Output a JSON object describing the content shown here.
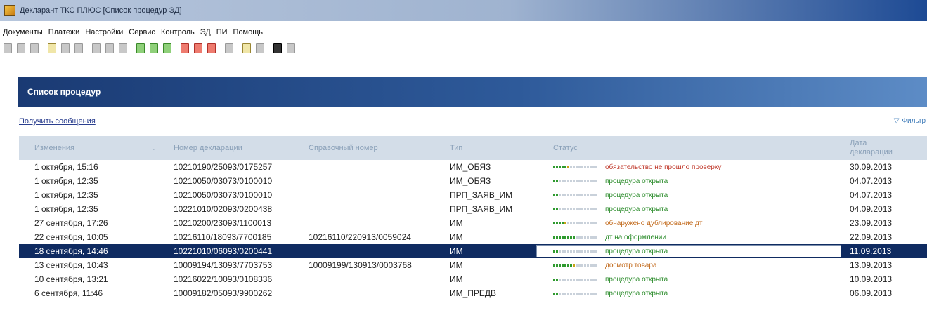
{
  "window": {
    "title": "Декларант ТКС ПЛЮС [Список процедур ЭД]"
  },
  "menu": [
    "Документы",
    "Платежи",
    "Настройки",
    "Сервис",
    "Контроль",
    "ЭД",
    "ПИ",
    "Помощь"
  ],
  "toolbar": {
    "icons": [
      {
        "name": "print-icon",
        "style": "gray"
      },
      {
        "name": "save-icon",
        "style": "gray"
      },
      {
        "name": "preview-icon",
        "style": "gray"
      },
      {
        "name": "sep"
      },
      {
        "name": "document-icon",
        "style": "doc"
      },
      {
        "name": "send-icon",
        "style": "gray"
      },
      {
        "name": "binoculars-icon",
        "style": "gray"
      },
      {
        "name": "sep"
      },
      {
        "name": "doc-new-icon",
        "style": "gray"
      },
      {
        "name": "doc-copy-icon",
        "style": "gray"
      },
      {
        "name": "doc-stack-icon",
        "style": "gray"
      },
      {
        "name": "sep"
      },
      {
        "name": "green-doc-icon",
        "style": "green"
      },
      {
        "name": "green-doc2-icon",
        "style": "green"
      },
      {
        "name": "green-stack-icon",
        "style": "green"
      },
      {
        "name": "sep"
      },
      {
        "name": "red-doc-icon",
        "style": "red"
      },
      {
        "name": "red-doc2-icon",
        "style": "red"
      },
      {
        "name": "red-stack-icon",
        "style": "red"
      },
      {
        "name": "sep"
      },
      {
        "name": "copy-icon",
        "style": "gray"
      },
      {
        "name": "sep"
      },
      {
        "name": "coin-icon",
        "style": "doc"
      },
      {
        "name": "book-icon",
        "style": "gray"
      },
      {
        "name": "sep"
      },
      {
        "name": "settings-icon",
        "style": "dark"
      },
      {
        "name": "list-icon",
        "style": "gray"
      }
    ]
  },
  "panel": {
    "title": "Список процедур",
    "get_messages": "Получить сообщения",
    "filter": "Фильтр"
  },
  "table": {
    "columns": {
      "changed": "Изменения",
      "decl": "Номер декларации",
      "ref": "Справочный номер",
      "type": "Тип",
      "status": "Статус",
      "date": "Дата декларации"
    },
    "rows": [
      {
        "changed": "1 октября, 15:16",
        "decl": "10210190/25093/0175257",
        "ref": "",
        "type": "ИМ_ОБЯЗ",
        "progress": 0.4,
        "status_color": "red",
        "status": "обязательство не прошло проверку",
        "date": "30.09.2013"
      },
      {
        "changed": "1 октября, 12:35",
        "decl": "10210050/03073/0100010",
        "ref": "",
        "type": "ИМ_ОБЯЗ",
        "progress": 0.1,
        "status_color": "green",
        "status": "процедура открыта",
        "date": "04.07.2013"
      },
      {
        "changed": "1 октября, 12:35",
        "decl": "10210050/03073/0100010",
        "ref": "",
        "type": "ПРП_ЗАЯВ_ИМ",
        "progress": 0.1,
        "status_color": "green",
        "status": "процедура открыта",
        "date": "04.07.2013"
      },
      {
        "changed": "1 октября, 12:35",
        "decl": "10221010/02093/0200438",
        "ref": "",
        "type": "ПРП_ЗАЯВ_ИМ",
        "progress": 0.1,
        "status_color": "green",
        "status": "процедура открыта",
        "date": "04.09.2013"
      },
      {
        "changed": "27 сентября, 17:26",
        "decl": "10210200/23093/1100013",
        "ref": "",
        "type": "ИМ",
        "progress": 0.3,
        "status_color": "orange",
        "status": "обнаружено дублирование дт",
        "date": "23.09.2013"
      },
      {
        "changed": "22 сентября, 10:05",
        "decl": "10216110/18093/7700185",
        "ref": "10216110/220913/0059024",
        "type": "ИМ",
        "progress": 0.5,
        "status_color": "green",
        "status": "дт на оформлении",
        "date": "22.09.2013"
      },
      {
        "changed": "18 сентября, 14:46",
        "decl": "10221010/06093/0200441",
        "ref": "",
        "type": "ИМ",
        "progress": 0.1,
        "status_color": "green",
        "status": "процедура открыта",
        "date": "11.09.2013",
        "selected": true
      },
      {
        "changed": "13 сентября, 10:43",
        "decl": "10009194/13093/7703753",
        "ref": "10009199/130913/0003768",
        "type": "ИМ",
        "progress": 0.5,
        "status_color": "orange",
        "status": "досмотр товара",
        "date": "13.09.2013"
      },
      {
        "changed": "10 сентября, 13:21",
        "decl": "10216022/10093/0108336",
        "ref": "",
        "type": "ИМ",
        "progress": 0.1,
        "status_color": "green",
        "status": "процедура открыта",
        "date": "10.09.2013"
      },
      {
        "changed": "6 сентября, 11:46",
        "decl": "10009182/05093/9900262",
        "ref": "",
        "type": "ИМ_ПРЕДВ",
        "progress": 0.1,
        "status_color": "green",
        "status": "процедура открыта",
        "date": "06.09.2013"
      }
    ]
  }
}
